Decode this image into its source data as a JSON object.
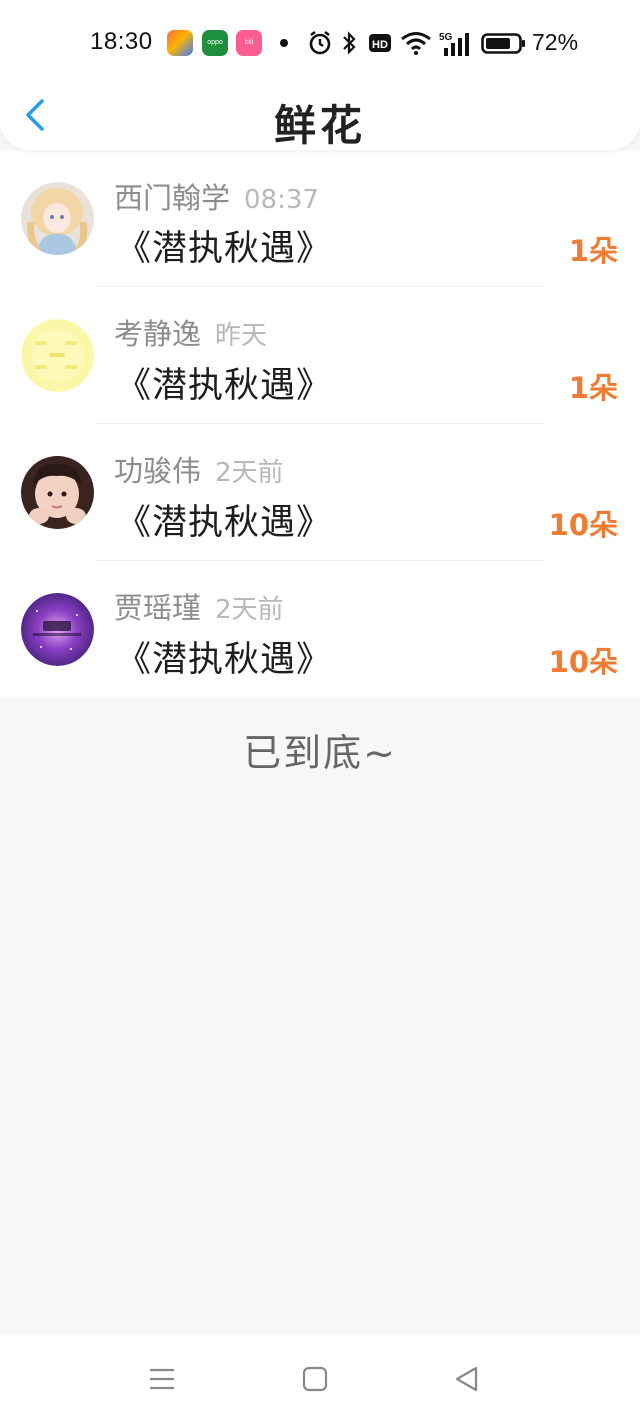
{
  "status_bar": {
    "time": "18:30",
    "battery_percent": "72%",
    "app_icons": [
      "tool-app-icon",
      "oppo-store-icon",
      "bilibili-icon"
    ],
    "system_icons": [
      "alarm-icon",
      "bluetooth-icon",
      "hd-icon",
      "wifi-icon",
      "signal-5g-icon",
      "battery-icon"
    ]
  },
  "header": {
    "title": "鲜花",
    "back_icon": "chevron-left-icon"
  },
  "colors": {
    "accent": "#2b9de6",
    "count": "#ee7d33",
    "background": "#f8f6f7"
  },
  "gifts": [
    {
      "name": "西门翰学",
      "time": "08:37",
      "book": "《潜执秋遇》",
      "count": "1朵",
      "avatar": "anime-girl-avatar"
    },
    {
      "name": "考静逸",
      "time": "昨天",
      "book": "《潜执秋遇》",
      "count": "1朵",
      "avatar": "yellow-text-avatar"
    },
    {
      "name": "功骏伟",
      "time": "2天前",
      "book": "《潜执秋遇》",
      "count": "10朵",
      "avatar": "child-photo-avatar"
    },
    {
      "name": "贾瑶瑾",
      "time": "2天前",
      "book": "《潜执秋遇》",
      "count": "10朵",
      "avatar": "galaxy-avatar"
    }
  ],
  "end_text": "已到底~",
  "nav_bar": {
    "icons": [
      "menu-icon",
      "home-icon",
      "back-triangle-icon"
    ]
  }
}
